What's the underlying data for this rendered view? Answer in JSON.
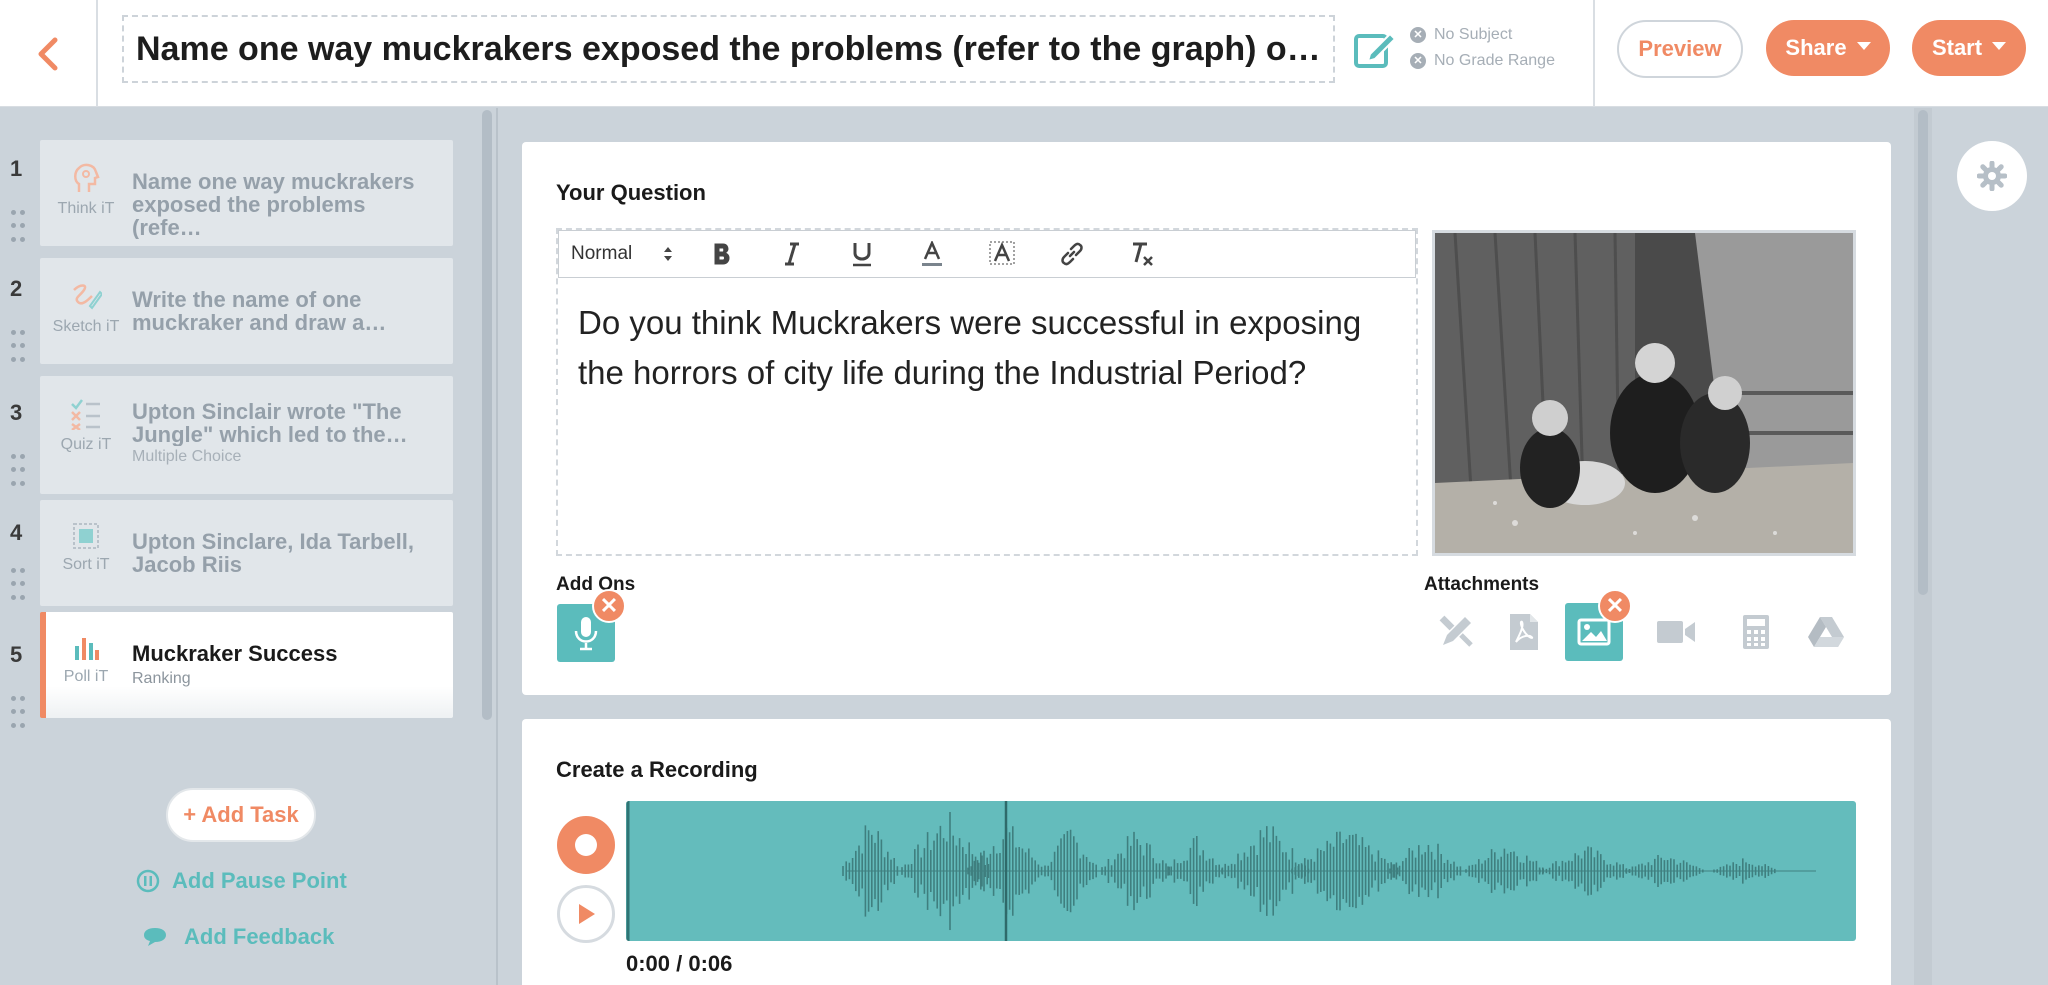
{
  "header": {
    "title": "Name one way muckrakers exposed the problems (refer to the graph) of r...",
    "subject": "No Subject",
    "grade_range": "No Grade Range",
    "preview_label": "Preview",
    "share_label": "Share",
    "start_label": "Start"
  },
  "tasks": [
    {
      "num": "1",
      "type": "Think iT",
      "title": "Name one way muckrakers exposed the problems (refe…",
      "sub": ""
    },
    {
      "num": "2",
      "type": "Sketch iT",
      "title": "Write the name of one muckraker and draw a…",
      "sub": ""
    },
    {
      "num": "3",
      "type": "Quiz iT",
      "title": "Upton Sinclair wrote \"The Jungle\" which led to the…",
      "sub": "Multiple Choice"
    },
    {
      "num": "4",
      "type": "Sort iT",
      "title": "Upton Sinclare, Ida Tarbell, Jacob Riis",
      "sub": ""
    },
    {
      "num": "5",
      "type": "Poll iT",
      "title": "Muckraker Success",
      "sub": "Ranking"
    }
  ],
  "sidebar": {
    "add_task": "+ Add Task",
    "add_pause": "Add Pause Point",
    "add_feedback": "Add Feedback"
  },
  "question": {
    "label": "Your Question",
    "format": "Normal",
    "text": "Do you think Muckrakers were successful in exposing the horrors of city life during the Industrial Period?",
    "addons_label": "Add Ons",
    "attachments_label": "Attachments"
  },
  "recording": {
    "label": "Create a Recording",
    "time": "0:00 / 0:06",
    "progress": 0.0
  },
  "colors": {
    "accent": "#f08a64",
    "teal": "#5bbcbc",
    "background": "#cbd3da"
  },
  "icons": [
    "back-chevron-icon",
    "edit-icon",
    "gear-icon",
    "bold-icon",
    "italic-icon",
    "underline-icon",
    "text-color-icon",
    "highlight-icon",
    "link-icon",
    "clear-format-icon",
    "microphone-icon",
    "draw-icon",
    "pdf-icon",
    "image-icon",
    "video-icon",
    "calculator-icon",
    "google-drive-icon",
    "record-icon",
    "play-icon"
  ]
}
